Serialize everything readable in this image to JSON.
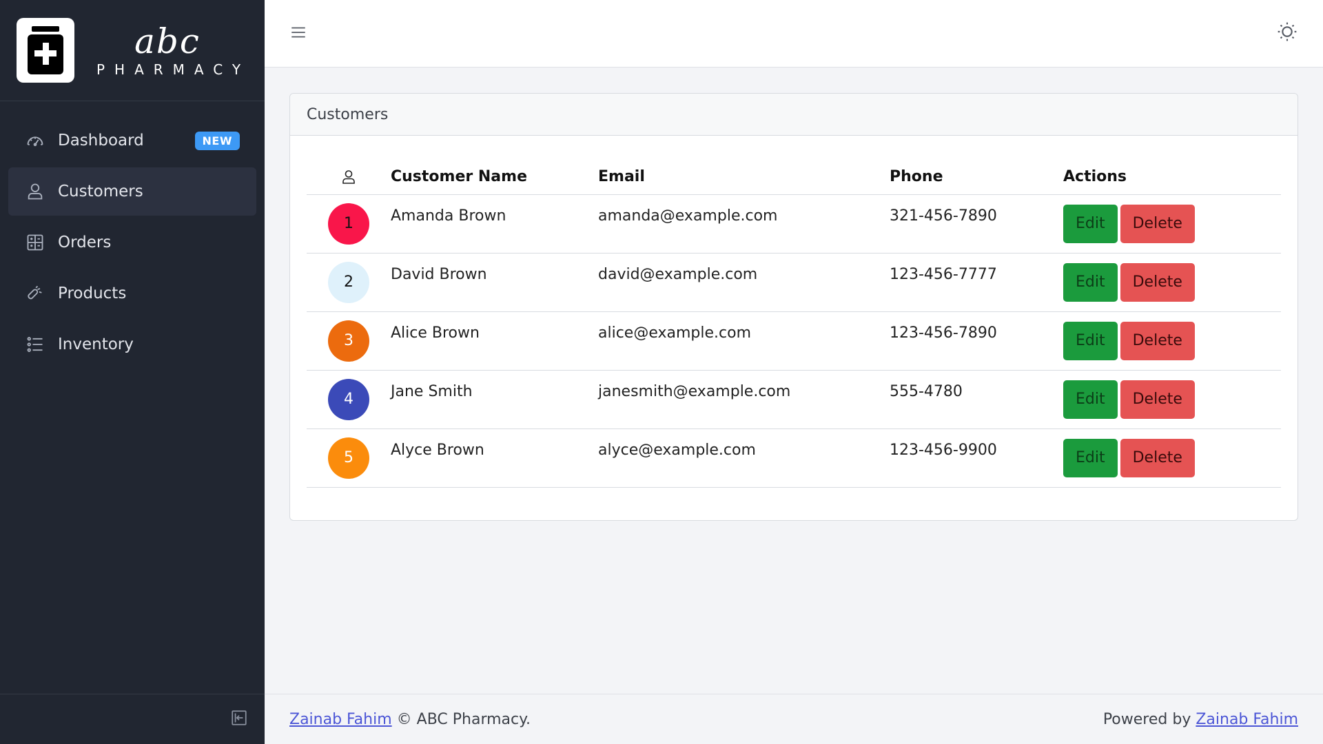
{
  "brand": {
    "script": "abc",
    "word": "PHARMACY"
  },
  "sidebar": {
    "items": [
      {
        "label": "Dashboard",
        "icon": "speedometer-icon",
        "badge": "NEW"
      },
      {
        "label": "Customers",
        "icon": "user-icon",
        "active": true
      },
      {
        "label": "Orders",
        "icon": "calculator-icon"
      },
      {
        "label": "Products",
        "icon": "drop-icon"
      },
      {
        "label": "Inventory",
        "icon": "list-icon"
      }
    ],
    "collapse_icon": "sidebar-collapse-icon"
  },
  "header": {
    "menu_icon": "hamburger-icon",
    "theme_icon": "sun-icon"
  },
  "customers": {
    "title": "Customers",
    "columns": {
      "icon": "user-icon",
      "name": "Customer Name",
      "email": "Email",
      "phone": "Phone",
      "actions": "Actions"
    },
    "edit_label": "Edit",
    "delete_label": "Delete",
    "rows": [
      {
        "num": "1",
        "name": "Amanda Brown",
        "email": "amanda@example.com",
        "phone": "321-456-7890",
        "avatar_bg": "#f9164a",
        "avatar_fg": "#111111"
      },
      {
        "num": "2",
        "name": "David Brown",
        "email": "david@example.com",
        "phone": "123-456-7777",
        "avatar_bg": "#dff1fb",
        "avatar_fg": "#111111"
      },
      {
        "num": "3",
        "name": "Alice Brown",
        "email": "alice@example.com",
        "phone": "123-456-7890",
        "avatar_bg": "#ec6b0e",
        "avatar_fg": "#ffffff"
      },
      {
        "num": "4",
        "name": "Jane Smith",
        "email": "janesmith@example.com",
        "phone": "555-4780",
        "avatar_bg": "#3b4ab8",
        "avatar_fg": "#ffffff"
      },
      {
        "num": "5",
        "name": "Alyce Brown",
        "email": "alyce@example.com",
        "phone": "123-456-9900",
        "avatar_bg": "#fb8c0c",
        "avatar_fg": "#ffffff"
      }
    ]
  },
  "footer": {
    "left_link": "Zainab Fahim",
    "left_text": "© ABC Pharmacy.",
    "right_text": "Powered by",
    "right_link": "Zainab Fahim"
  },
  "colors": {
    "sidebar_bg": "#212631",
    "accent": "#3d99f5",
    "edit": "#1b9b3d",
    "delete": "#e55353",
    "link": "#4b55d6"
  }
}
